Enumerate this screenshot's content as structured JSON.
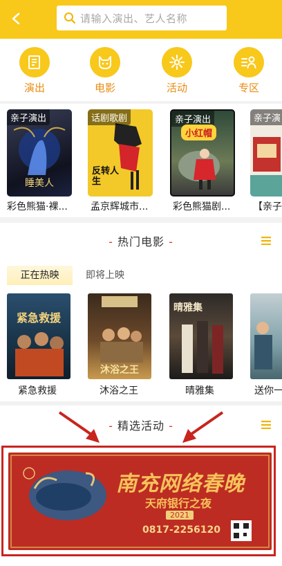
{
  "header": {
    "search_placeholder": "请输入演出、艺人名称"
  },
  "categories": [
    {
      "label": "演出",
      "icon": "ticket-icon"
    },
    {
      "label": "电影",
      "icon": "cat-face-icon"
    },
    {
      "label": "活动",
      "icon": "flower-icon"
    },
    {
      "label": "专区",
      "icon": "user-list-icon"
    }
  ],
  "shows": [
    {
      "tag": "亲子演出",
      "poster_text": "睡美人",
      "caption": "彩色熊猫·裸..."
    },
    {
      "tag": "话剧歌剧",
      "poster_text": "反转人生",
      "caption": "孟京辉城市..."
    },
    {
      "tag": "亲子演出",
      "poster_text": "小红帽",
      "caption": "彩色熊猫剧..."
    },
    {
      "tag": "亲子演",
      "poster_text": "",
      "caption": "【亲子"
    }
  ],
  "hot_movies": {
    "title": "热门电影",
    "tabs": [
      "正在热映",
      "即将上映"
    ],
    "movies": [
      {
        "title": "紧急救援",
        "poster_text": "紧急救援"
      },
      {
        "title": "沐浴之王",
        "poster_text": "沐浴之王"
      },
      {
        "title": "晴雅集",
        "poster_text": "晴雅集"
      },
      {
        "title": "送你一",
        "poster_text": ""
      }
    ]
  },
  "activities": {
    "title": "精选活动",
    "banner": {
      "headline": "南充网络春晚",
      "subline": "天府银行之夜",
      "year": "2021",
      "phone": "0817-2256120"
    }
  },
  "colors": {
    "brand_yellow": "#f8c81b",
    "category_text": "#e98c10",
    "highlight_red": "#c8241e"
  }
}
